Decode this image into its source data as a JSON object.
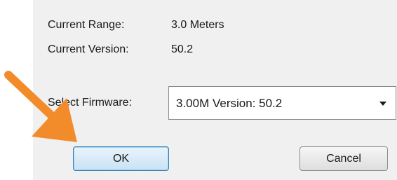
{
  "dialog": {
    "current_range_label": "Current Range:",
    "current_range_value": "3.0 Meters",
    "current_version_label": "Current Version:",
    "current_version_value": "50.2",
    "select_firmware_label": "Select Firmware:",
    "firmware_selected": "3.00M  Version: 50.2",
    "ok_label": "OK",
    "cancel_label": "Cancel"
  },
  "annotation": {
    "arrow_color": "#f28c2b",
    "icon": "arrow-pointer-icon"
  }
}
